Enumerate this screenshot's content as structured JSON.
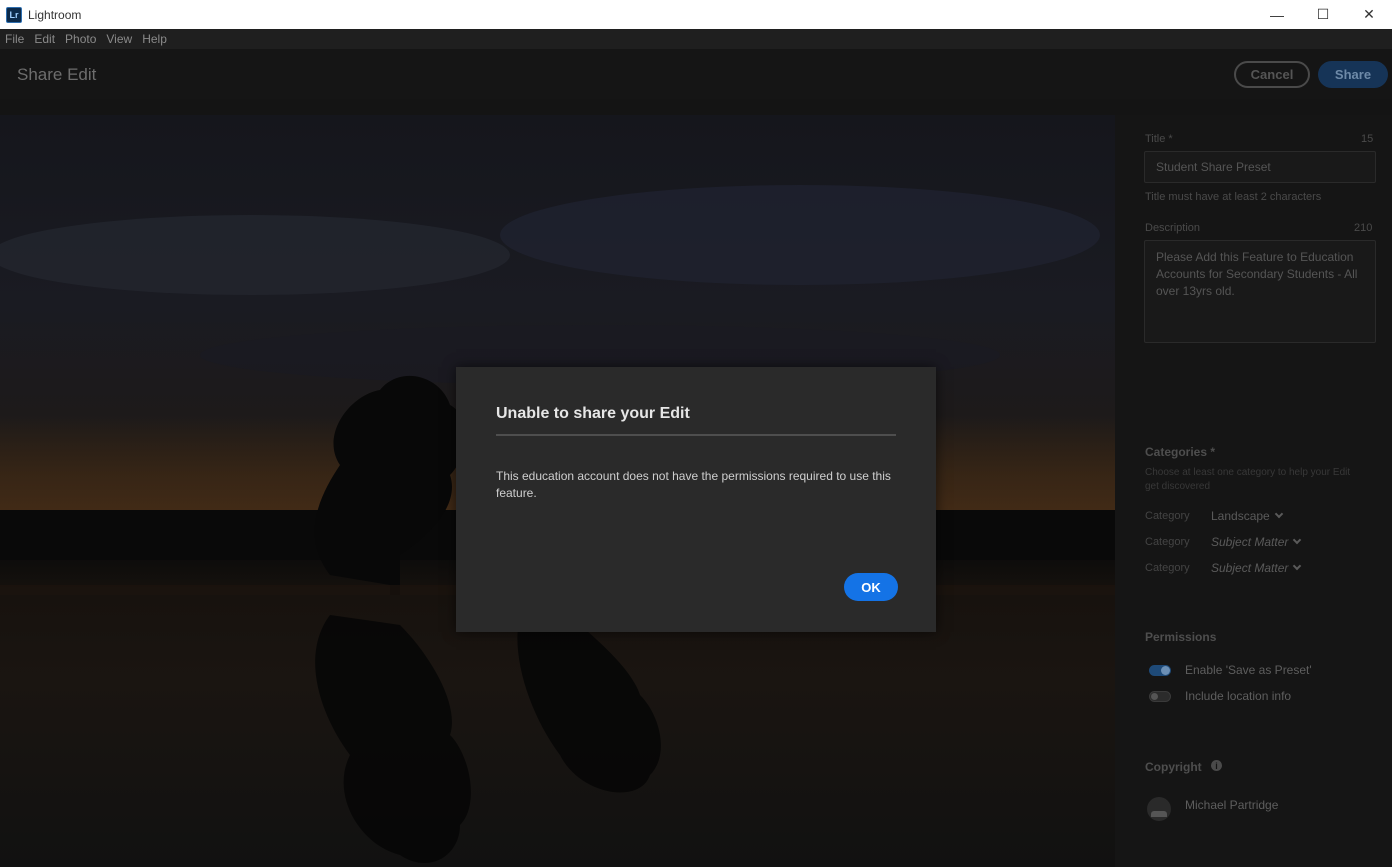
{
  "window": {
    "app_logo": "Lr",
    "app_title": "Lightroom",
    "controls": {
      "minimize": "—",
      "maximize": "☐",
      "close": "✕"
    }
  },
  "menu": [
    "File",
    "Edit",
    "Photo",
    "View",
    "Help"
  ],
  "header": {
    "title": "Share Edit",
    "cancel_label": "Cancel",
    "share_label": "Share"
  },
  "panel": {
    "title_label": "Title *",
    "title_count": "15",
    "title_value": "Student Share Preset",
    "title_hint": "Title must have at least 2 characters",
    "description_label": "Description",
    "description_count": "210",
    "description_value": "Please Add this Feature to Education Accounts for Secondary Students - All over 13yrs old.",
    "categories_label": "Categories *",
    "categories_hint": "Choose at least one category to help your Edit get discovered",
    "categories": [
      {
        "label": "Category",
        "value": "Landscape",
        "placeholder": false
      },
      {
        "label": "Category",
        "value": "Subject Matter",
        "placeholder": true
      },
      {
        "label": "Category",
        "value": "Subject Matter",
        "placeholder": true
      }
    ],
    "permissions_label": "Permissions",
    "permissions": [
      {
        "label": "Enable 'Save as Preset'",
        "enabled": true
      },
      {
        "label": "Include location info",
        "enabled": false
      }
    ],
    "copyright_label": "Copyright",
    "copyright_info_icon": "info-icon",
    "copyright_name": "Michael Partridge"
  },
  "modal": {
    "title": "Unable to share your Edit",
    "body": "This education account does not have the permissions required to use this feature.",
    "ok_label": "OK"
  },
  "colors": {
    "accent": "#1473e6",
    "modal_bg": "#2a2a2a",
    "background": "#141414"
  }
}
